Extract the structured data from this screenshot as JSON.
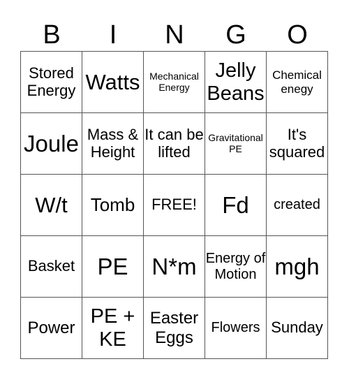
{
  "header": [
    "B",
    "I",
    "N",
    "G",
    "O"
  ],
  "cells": [
    [
      "Stored Energy",
      "Watts",
      "Mechanical Energy",
      "Jelly Beans",
      "Chemical enegy"
    ],
    [
      "Joule",
      "Mass & Height",
      "It can be lifted",
      "Gravitational PE",
      "It's squared"
    ],
    [
      "W/t",
      "Tomb",
      "FREE!",
      "Fd",
      "created"
    ],
    [
      "Basket",
      "PE",
      "N*m",
      "Energy of Motion",
      "mgh"
    ],
    [
      "Power",
      "PE + KE",
      "Easter Eggs",
      "Flowers",
      "Sunday"
    ]
  ]
}
